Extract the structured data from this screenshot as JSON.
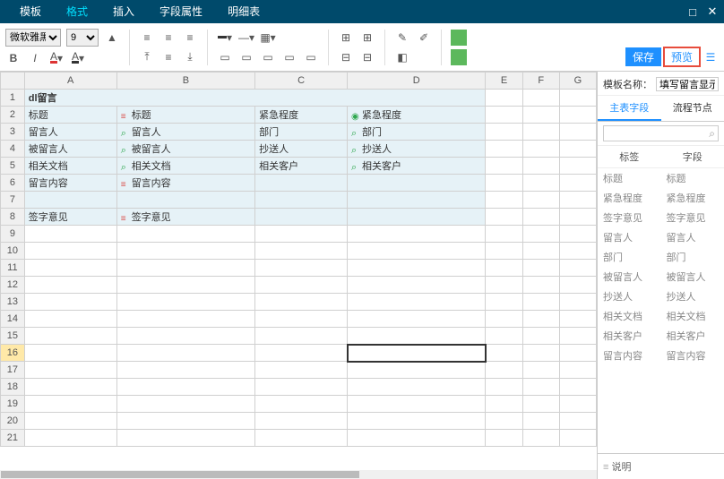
{
  "menu": {
    "items": [
      "模板",
      "格式",
      "插入",
      "字段属性",
      "明细表"
    ],
    "active_index": 1
  },
  "toolbar": {
    "font_name": "微软雅黑",
    "font_size": "9",
    "save": "保存",
    "preview": "预览"
  },
  "sheet": {
    "cols": [
      "A",
      "B",
      "C",
      "D",
      "E",
      "F",
      "G"
    ],
    "title": "dl留言",
    "selected_row": 16,
    "rows": [
      {
        "r": 2,
        "cells": [
          {
            "t": "标题",
            "f": true
          },
          {
            "t": "标题",
            "f": true,
            "ic": "text"
          },
          {
            "t": "紧急程度",
            "f": true
          },
          {
            "t": "紧急程度",
            "f": true,
            "ic": "radio"
          },
          {
            "t": "",
            "f": false
          },
          {
            "t": "",
            "f": false
          },
          {
            "t": "",
            "f": false
          }
        ]
      },
      {
        "r": 3,
        "cells": [
          {
            "t": "留言人",
            "f": true
          },
          {
            "t": "留言人",
            "f": true,
            "ic": "search"
          },
          {
            "t": "部门",
            "f": true
          },
          {
            "t": "部门",
            "f": true,
            "ic": "search"
          },
          {
            "t": "",
            "f": false
          },
          {
            "t": "",
            "f": false
          },
          {
            "t": "",
            "f": false
          }
        ]
      },
      {
        "r": 4,
        "cells": [
          {
            "t": "被留言人",
            "f": true
          },
          {
            "t": "被留言人",
            "f": true,
            "ic": "search"
          },
          {
            "t": "抄送人",
            "f": true
          },
          {
            "t": "抄送人",
            "f": true,
            "ic": "search"
          },
          {
            "t": "",
            "f": false
          },
          {
            "t": "",
            "f": false
          },
          {
            "t": "",
            "f": false
          }
        ]
      },
      {
        "r": 5,
        "cells": [
          {
            "t": "相关文档",
            "f": true
          },
          {
            "t": "相关文档",
            "f": true,
            "ic": "search"
          },
          {
            "t": "相关客户",
            "f": true
          },
          {
            "t": "相关客户",
            "f": true,
            "ic": "search"
          },
          {
            "t": "",
            "f": false
          },
          {
            "t": "",
            "f": false
          },
          {
            "t": "",
            "f": false
          }
        ]
      },
      {
        "r": 6,
        "cells": [
          {
            "t": "留言内容",
            "f": true
          },
          {
            "t": "留言内容",
            "f": true,
            "ic": "text"
          },
          {
            "t": "",
            "f": true
          },
          {
            "t": "",
            "f": true
          },
          {
            "t": "",
            "f": false
          },
          {
            "t": "",
            "f": false
          },
          {
            "t": "",
            "f": false
          }
        ]
      },
      {
        "r": 7,
        "cells": [
          {
            "t": "",
            "f": true
          },
          {
            "t": "",
            "f": true
          },
          {
            "t": "",
            "f": true
          },
          {
            "t": "",
            "f": true
          },
          {
            "t": "",
            "f": false
          },
          {
            "t": "",
            "f": false
          },
          {
            "t": "",
            "f": false
          }
        ]
      },
      {
        "r": 8,
        "cells": [
          {
            "t": "签字意见",
            "f": true
          },
          {
            "t": "签字意见",
            "f": true,
            "ic": "text"
          },
          {
            "t": "",
            "f": true
          },
          {
            "t": "",
            "f": true
          },
          {
            "t": "",
            "f": false
          },
          {
            "t": "",
            "f": false
          },
          {
            "t": "",
            "f": false
          }
        ]
      }
    ],
    "empty_rows_to": 21
  },
  "right": {
    "label": "模板名称：",
    "name": "填写留言显示模板",
    "tabs": [
      "主表字段",
      "流程节点"
    ],
    "active_tab": 0,
    "col_headers": [
      "标签",
      "字段"
    ],
    "fields": [
      "标题",
      "紧急程度",
      "签字意见",
      "留言人",
      "部门",
      "被留言人",
      "抄送人",
      "相关文档",
      "相关客户",
      "留言内容"
    ],
    "footer": "说明"
  }
}
